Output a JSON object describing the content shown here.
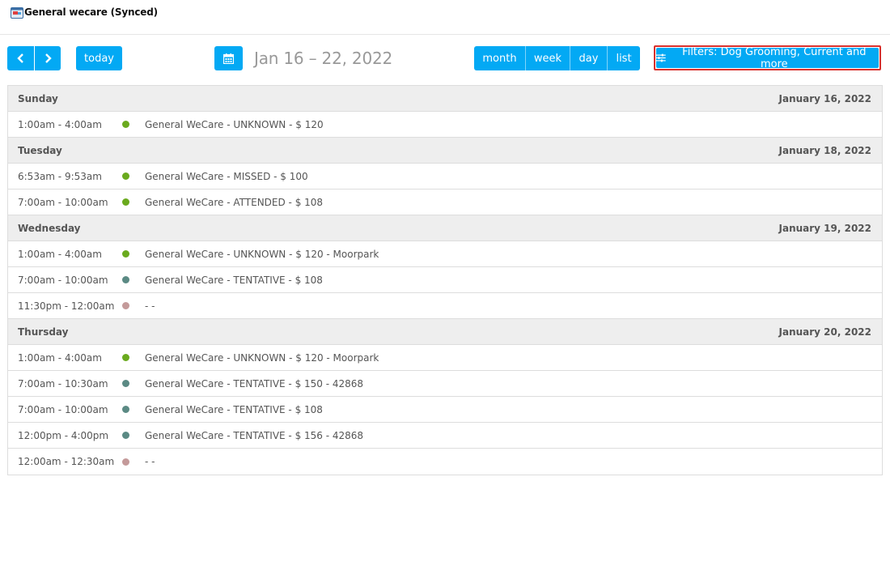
{
  "header": {
    "title": "General wecare (Synced)",
    "icon": "calendar-app-icon"
  },
  "toolbar": {
    "prev_icon": "chevron-left-icon",
    "next_icon": "chevron-right-icon",
    "today_label": "today",
    "calendar_icon": "calendar-icon",
    "range_title": "Jan 16 – 22, 2022",
    "views": [
      "month",
      "week",
      "day",
      "list"
    ],
    "filter_label": "Filters: Dog Grooming, Current and more",
    "filter_icon": "sliders-icon"
  },
  "colors": {
    "accent": "#03a9f4",
    "green": "#6aaa1e",
    "teal": "#5b8a84",
    "pink": "#c49a9a",
    "highlight": "#d9302c"
  },
  "days": [
    {
      "name": "Sunday",
      "date": "January 16, 2022",
      "events": [
        {
          "time": "1:00am - 4:00am",
          "dot": "#6aaa1e",
          "title": "General WeCare - UNKNOWN - $ 120"
        }
      ]
    },
    {
      "name": "Tuesday",
      "date": "January 18, 2022",
      "events": [
        {
          "time": "6:53am - 9:53am",
          "dot": "#6aaa1e",
          "title": "General WeCare - MISSED - $ 100"
        },
        {
          "time": "7:00am - 10:00am",
          "dot": "#6aaa1e",
          "title": "General WeCare - ATTENDED - $ 108"
        }
      ]
    },
    {
      "name": "Wednesday",
      "date": "January 19, 2022",
      "events": [
        {
          "time": "1:00am - 4:00am",
          "dot": "#6aaa1e",
          "title": "General WeCare - UNKNOWN - $ 120 - Moorpark"
        },
        {
          "time": "7:00am - 10:00am",
          "dot": "#5b8a84",
          "title": "General WeCare - TENTATIVE - $ 108"
        },
        {
          "time": "11:30pm - 12:00am",
          "dot": "#c49a9a",
          "title": "- -"
        }
      ]
    },
    {
      "name": "Thursday",
      "date": "January 20, 2022",
      "events": [
        {
          "time": "1:00am - 4:00am",
          "dot": "#6aaa1e",
          "title": "General WeCare - UNKNOWN - $ 120 - Moorpark"
        },
        {
          "time": "7:00am - 10:30am",
          "dot": "#5b8a84",
          "title": "General WeCare - TENTATIVE - $ 150 - 42868"
        },
        {
          "time": "7:00am - 10:00am",
          "dot": "#5b8a84",
          "title": "General WeCare - TENTATIVE - $ 108"
        },
        {
          "time": "12:00pm - 4:00pm",
          "dot": "#5b8a84",
          "title": "General WeCare - TENTATIVE - $ 156 - 42868"
        },
        {
          "time": "12:00am - 12:30am",
          "dot": "#c49a9a",
          "title": "- -"
        }
      ]
    }
  ]
}
